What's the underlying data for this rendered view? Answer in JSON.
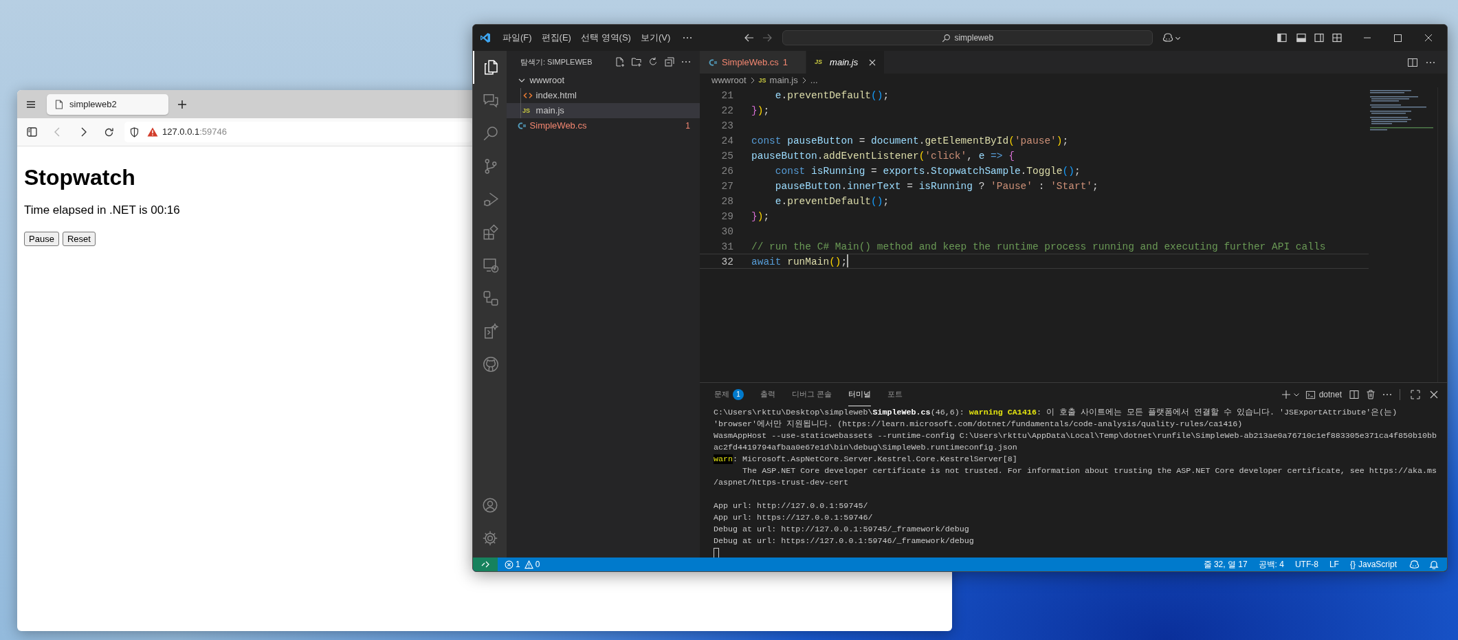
{
  "browser": {
    "tab_title": "simpleweb2",
    "back_disabled": true,
    "address": {
      "host": "127.0.0.1",
      "port": ":59746"
    },
    "page": {
      "heading": "Stopwatch",
      "text": "Time elapsed in .NET is 00:16",
      "buttons": [
        "Pause",
        "Reset"
      ]
    }
  },
  "vscode": {
    "menu": [
      "파일(F)",
      "편집(E)",
      "선택 영역(S)",
      "보기(V)"
    ],
    "search": "simpleweb",
    "activity_bar": [
      {
        "selected": true
      },
      {
        "selected": false
      },
      {
        "selected": false
      },
      {
        "selected": false
      },
      {
        "selected": false
      },
      {
        "selected": false
      },
      {
        "selected": false
      },
      {
        "selected": false
      },
      {
        "selected": false
      },
      {
        "selected": false
      }
    ],
    "explorer": {
      "title": "탐색기: SIMPLEWEB",
      "tree": [
        {
          "label": "wwwroot",
          "kind": "folder",
          "expanded": true,
          "selected": false,
          "error": false,
          "children": [
            {
              "label": "index.html",
              "kind": "html",
              "selected": false,
              "error": false
            },
            {
              "label": "main.js",
              "kind": "js",
              "icon_text": "JS",
              "selected": true,
              "error": false
            }
          ]
        },
        {
          "label": "SimpleWeb.cs",
          "kind": "csharp",
          "selected": false,
          "error": true,
          "badge": "1"
        }
      ]
    },
    "tabs": [
      {
        "label": "SimpleWeb.cs",
        "kind": "csharp",
        "badge": "1",
        "error": true,
        "preview": false,
        "selected": false
      },
      {
        "label": "main.js",
        "kind": "js",
        "icon_text": "JS",
        "error": false,
        "preview": true,
        "selected": true
      }
    ],
    "breadcrumb": [
      {
        "label": "wwwroot",
        "kind": "folder"
      },
      {
        "label": "main.js",
        "kind": "js",
        "icon_text": "JS"
      },
      {
        "label": "...",
        "kind": "more"
      }
    ],
    "code_lines": [
      {
        "number": "21",
        "current": false,
        "tokens": [
          {
            "kind": "var",
            "text": "    e"
          },
          {
            "kind": "op",
            "text": "."
          },
          {
            "kind": "fn",
            "text": "preventDefault"
          },
          {
            "kind": "b3",
            "text": "()"
          },
          {
            "kind": "op",
            "text": ";"
          }
        ]
      },
      {
        "number": "22",
        "current": false,
        "tokens": [
          {
            "kind": "b2",
            "text": "}"
          },
          {
            "kind": "b1",
            "text": ")"
          },
          {
            "kind": "op",
            "text": ";"
          }
        ]
      },
      {
        "number": "23",
        "current": false
      },
      {
        "number": "24",
        "current": false,
        "tokens": [
          {
            "kind": "kw",
            "text": "const"
          },
          {
            "kind": "var",
            "text": " pauseButton"
          },
          {
            "kind": "op",
            "text": " = "
          },
          {
            "kind": "var",
            "text": "document"
          },
          {
            "kind": "op",
            "text": "."
          },
          {
            "kind": "fn",
            "text": "getElementById"
          },
          {
            "kind": "b1",
            "text": "("
          },
          {
            "kind": "str",
            "text": "'pause'"
          },
          {
            "kind": "b1",
            "text": ")"
          },
          {
            "kind": "op",
            "text": ";"
          }
        ]
      },
      {
        "number": "25",
        "current": false,
        "tokens": [
          {
            "kind": "var",
            "text": "pauseButton"
          },
          {
            "kind": "op",
            "text": "."
          },
          {
            "kind": "fn",
            "text": "addEventListener"
          },
          {
            "kind": "b1",
            "text": "("
          },
          {
            "kind": "str",
            "text": "'click'"
          },
          {
            "kind": "op",
            "text": ", "
          },
          {
            "kind": "var",
            "text": "e"
          },
          {
            "kind": "kw",
            "text": " =>"
          },
          {
            "kind": "b2",
            "text": " {"
          }
        ]
      },
      {
        "number": "26",
        "current": false,
        "tokens": [
          {
            "kind": "kw",
            "text": "    const"
          },
          {
            "kind": "var",
            "text": " isRunning"
          },
          {
            "kind": "op",
            "text": " = "
          },
          {
            "kind": "var",
            "text": "exports"
          },
          {
            "kind": "op",
            "text": "."
          },
          {
            "kind": "var",
            "text": "StopwatchSample"
          },
          {
            "kind": "op",
            "text": "."
          },
          {
            "kind": "fn",
            "text": "Toggle"
          },
          {
            "kind": "b3",
            "text": "()"
          },
          {
            "kind": "op",
            "text": ";"
          }
        ]
      },
      {
        "number": "27",
        "current": false,
        "tokens": [
          {
            "kind": "var",
            "text": "    pauseButton"
          },
          {
            "kind": "op",
            "text": "."
          },
          {
            "kind": "var",
            "text": "innerText"
          },
          {
            "kind": "op",
            "text": " = "
          },
          {
            "kind": "var",
            "text": "isRunning"
          },
          {
            "kind": "op",
            "text": " ? "
          },
          {
            "kind": "str",
            "text": "'Pause'"
          },
          {
            "kind": "op",
            "text": " : "
          },
          {
            "kind": "str",
            "text": "'Start'"
          },
          {
            "kind": "op",
            "text": ";"
          }
        ]
      },
      {
        "number": "28",
        "current": false,
        "tokens": [
          {
            "kind": "var",
            "text": "    e"
          },
          {
            "kind": "op",
            "text": "."
          },
          {
            "kind": "fn",
            "text": "preventDefault"
          },
          {
            "kind": "b3",
            "text": "()"
          },
          {
            "kind": "op",
            "text": ";"
          }
        ]
      },
      {
        "number": "29",
        "current": false,
        "tokens": [
          {
            "kind": "b2",
            "text": "}"
          },
          {
            "kind": "b1",
            "text": ")"
          },
          {
            "kind": "op",
            "text": ";"
          }
        ]
      },
      {
        "number": "30",
        "current": false
      },
      {
        "number": "31",
        "current": false,
        "tokens": [
          {
            "kind": "cm",
            "text": "// run the C# Main() method and keep the runtime process running and executing further API calls"
          }
        ]
      },
      {
        "number": "32",
        "current": true,
        "tokens": [
          {
            "kind": "kw",
            "text": "await"
          },
          {
            "kind": "fn",
            "text": " runMain"
          },
          {
            "kind": "b1",
            "text": "()"
          },
          {
            "kind": "op",
            "text": ";"
          }
        ]
      }
    ],
    "panel": {
      "tabs": [
        {
          "label": "문제",
          "badge": "1",
          "selected": false
        },
        {
          "label": "출력",
          "selected": false
        },
        {
          "label": "디버그 콘솔",
          "selected": false
        },
        {
          "label": "터미널",
          "selected": true
        },
        {
          "label": "포트",
          "selected": false
        }
      ],
      "terminal_name": "dotnet",
      "terminal_groups": [
        {
          "lines": [
            {
              "segments": [
                {
                  "kind": "plain",
                  "text": "C:\\Users\\rkttu\\Desktop\\simpleweb\\"
                },
                {
                  "kind": "bold",
                  "text": "SimpleWeb.cs"
                },
                {
                  "kind": "plain",
                  "text": "(46,6): "
                },
                {
                  "kind": "warning",
                  "text": "warning CA1416"
                },
                {
                  "kind": "plain",
                  "text": ": 이 호출 사이트에는 모든 플랫폼에서 연결할 수 있습니다. 'JSExportAttribute'은(는)"
                }
              ]
            },
            {
              "segments": [
                {
                  "kind": "plain",
                  "text": "'browser'에서만 지원됩니다. (https://learn.microsoft.com/dotnet/fundamentals/code-analysis/quality-rules/ca1416)"
                }
              ]
            },
            {
              "segments": [
                {
                  "kind": "plain",
                  "text": "WasmAppHost --use-staticwebassets --runtime-config C:\\Users\\rkttu\\AppData\\Local\\Temp\\dotnet\\runfile\\SimpleWeb-ab213ae0a76710c1ef883305e371ca4f850b10bb"
                }
              ]
            },
            {
              "segments": [
                {
                  "kind": "plain",
                  "text": "ac2fd4419794afbaa0e67e1d\\bin\\debug\\SimpleWeb.runtimeconfig.json"
                }
              ]
            },
            {
              "segments": [
                {
                  "kind": "label",
                  "text": "warn"
                },
                {
                  "kind": "plain",
                  "text": ": Microsoft.AspNetCore.Server.Kestrel.Core.KestrelServer[8]"
                }
              ]
            },
            {
              "segments": [
                {
                  "kind": "plain",
                  "text": "      The ASP.NET Core developer certificate is not trusted. For information about trusting the ASP.NET Core developer certificate, see https://aka.ms"
                }
              ]
            },
            {
              "segments": [
                {
                  "kind": "plain",
                  "text": "/aspnet/https-trust-dev-cert"
                }
              ]
            }
          ]
        },
        {
          "lines": [
            {
              "segments": [
                {
                  "kind": "plain",
                  "text": "App url: http://127.0.0.1:59745/"
                }
              ]
            },
            {
              "segments": [
                {
                  "kind": "plain",
                  "text": "App url: https://127.0.0.1:59746/"
                }
              ]
            },
            {
              "segments": [
                {
                  "kind": "plain",
                  "text": "Debug at url: http://127.0.0.1:59745/_framework/debug"
                }
              ]
            },
            {
              "segments": [
                {
                  "kind": "plain",
                  "text": "Debug at url: https://127.0.0.1:59746/_framework/debug"
                }
              ]
            }
          ]
        }
      ]
    },
    "status_bar": {
      "errors": "1",
      "warnings": "0",
      "items": [
        "줄 32, 열 17",
        "공백: 4",
        "UTF-8",
        "LF"
      ],
      "language_icon": "{}",
      "language": "JavaScript"
    }
  }
}
